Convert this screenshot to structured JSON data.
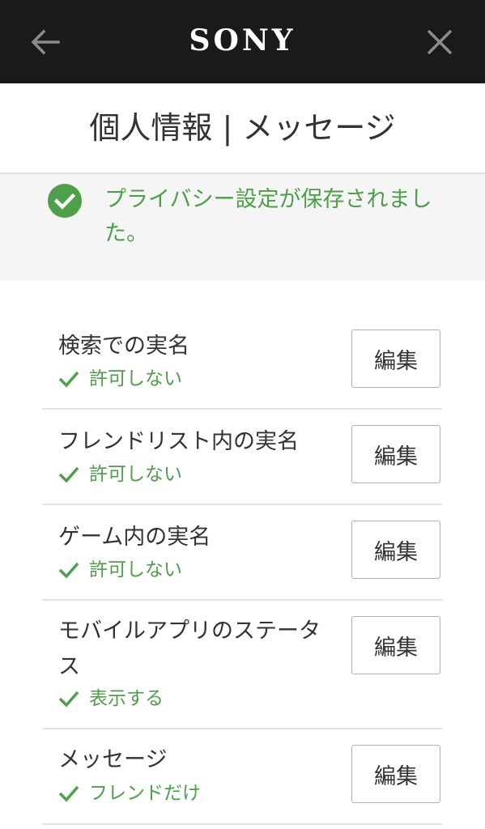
{
  "header": {
    "logo": "SONY",
    "back_icon": "arrow-left-icon",
    "close_icon": "close-icon"
  },
  "page": {
    "title": "個人情報 | メッセージ"
  },
  "banner": {
    "icon": "check-circle-icon",
    "text": "プライバシー設定が保存されました。"
  },
  "settings": [
    {
      "label": "検索での実名",
      "value": "許可しない",
      "button": "編集"
    },
    {
      "label": "フレンドリスト内の実名",
      "value": "許可しない",
      "button": "編集"
    },
    {
      "label": "ゲーム内の実名",
      "value": "許可しない",
      "button": "編集"
    },
    {
      "label": "モバイルアプリのステータス",
      "value": "表示する",
      "button": "編集"
    },
    {
      "label": "メッセージ",
      "value": "フレンドだけ",
      "button": "編集"
    }
  ],
  "colors": {
    "header_bg": "#1a1a1a",
    "accent_green": "#4e9e4a",
    "banner_bg": "#f5f5f5"
  }
}
